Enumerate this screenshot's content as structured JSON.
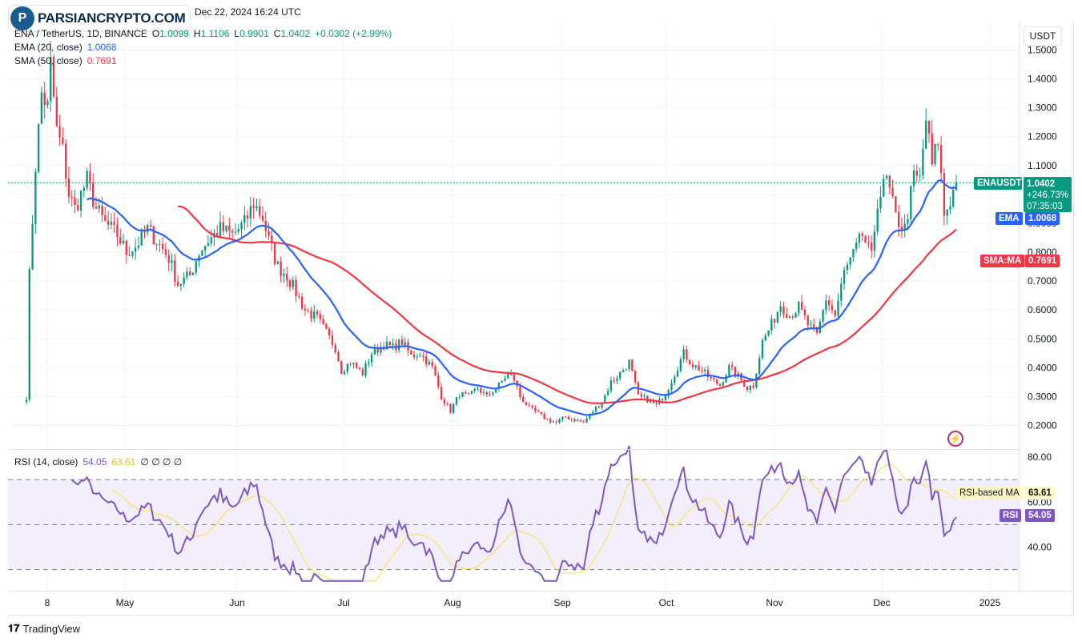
{
  "header": {
    "brand": "PARSIANCRYPTO.COM",
    "brand_logo_letter": "P",
    "date": "Dec 22, 2024 16:24 UTC"
  },
  "legend": {
    "symbol": "ENA / TetherUS, 1D, BINANCE",
    "open_label": "O",
    "open": "1.0099",
    "high_label": "H",
    "high": "1.1106",
    "low_label": "L",
    "low": "0.9901",
    "close_label": "C",
    "close": "1.0402",
    "change": "+0.0302 (+2.99%)",
    "ema_label": "EMA (20, close)",
    "ema_value": "1.0068",
    "sma_label": "SMA (50, close)",
    "sma_value": "0.7691",
    "rsi_label": "RSI (14, close)",
    "rsi_value": "54.05",
    "rsi_ma_value": "63.61",
    "rsi_extra": "∅ ∅ ∅ ∅"
  },
  "currency": "USDT",
  "price_tags": {
    "symbol": "ENAUSDT",
    "price": "1.0402",
    "change": "+246.73%",
    "countdown": "07:35:03",
    "ema_label": "EMA",
    "ema_value": "1.0068",
    "sma_label": "SMA:MA",
    "sma_value": "0.7691",
    "rsi_ma_label": "RSI-based MA",
    "rsi_ma_value": "63.61",
    "rsi_label": "RSI",
    "rsi_value": "54.05"
  },
  "footer": {
    "brand": "TradingView"
  },
  "colors": {
    "up": "#089981",
    "down": "#f23645",
    "ema": "#2962ff",
    "sma": "#f23645",
    "rsi": "#7e57c2",
    "rsi_ma": "#f7e26b",
    "rsi_band": "#f3eefc"
  },
  "chart_data": {
    "type": "candlestick",
    "price_axis": {
      "ticks": [
        "1.5000",
        "1.4000",
        "1.3000",
        "1.2000",
        "1.1000",
        "1.0000",
        "0.9000",
        "0.8000",
        "0.7000",
        "0.6000",
        "0.5000",
        "0.4000",
        "0.3000",
        "0.2000"
      ],
      "tick_values": [
        1.5,
        1.4,
        1.3,
        1.2,
        1.1,
        1.0,
        0.9,
        0.8,
        0.7,
        0.6,
        0.5,
        0.4,
        0.3,
        0.2
      ],
      "ylim": [
        0.15,
        1.55
      ]
    },
    "time_axis": {
      "ticks": [
        "8",
        "May",
        "Jun",
        "Jul",
        "Aug",
        "Sep",
        "Oct",
        "Nov",
        "Dec",
        "2025"
      ]
    },
    "rsi_axis": {
      "ticks": [
        "80.00",
        "60.00",
        "40.00"
      ],
      "tick_values": [
        80,
        60,
        40
      ],
      "overbought": 70,
      "oversold": 30,
      "ylim": [
        25,
        85
      ]
    },
    "price_anchors": [
      [
        0,
        0.3
      ],
      [
        1,
        0.72
      ],
      [
        3,
        1.1
      ],
      [
        5,
        1.35
      ],
      [
        7,
        1.3
      ],
      [
        8,
        1.45
      ],
      [
        10,
        1.22
      ],
      [
        12,
        1.15
      ],
      [
        14,
        1.0
      ],
      [
        16,
        0.95
      ],
      [
        18,
        1.0
      ],
      [
        20,
        1.05
      ],
      [
        23,
        0.95
      ],
      [
        26,
        0.9
      ],
      [
        30,
        0.86
      ],
      [
        33,
        0.8
      ],
      [
        36,
        0.82
      ],
      [
        40,
        0.88
      ],
      [
        43,
        0.84
      ],
      [
        47,
        0.78
      ],
      [
        50,
        0.69
      ],
      [
        54,
        0.72
      ],
      [
        57,
        0.8
      ],
      [
        60,
        0.84
      ],
      [
        64,
        0.88
      ],
      [
        68,
        0.86
      ],
      [
        72,
        0.9
      ],
      [
        75,
        0.97
      ],
      [
        78,
        0.92
      ],
      [
        80,
        0.84
      ],
      [
        83,
        0.75
      ],
      [
        86,
        0.72
      ],
      [
        89,
        0.66
      ],
      [
        92,
        0.6
      ],
      [
        96,
        0.57
      ],
      [
        99,
        0.52
      ],
      [
        102,
        0.47
      ],
      [
        104,
        0.39
      ],
      [
        107,
        0.42
      ],
      [
        111,
        0.38
      ],
      [
        114,
        0.45
      ],
      [
        118,
        0.48
      ],
      [
        121,
        0.47
      ],
      [
        124,
        0.49
      ],
      [
        127,
        0.44
      ],
      [
        130,
        0.45
      ],
      [
        134,
        0.4
      ],
      [
        137,
        0.3
      ],
      [
        140,
        0.25
      ],
      [
        143,
        0.31
      ],
      [
        146,
        0.3
      ],
      [
        149,
        0.33
      ],
      [
        152,
        0.3
      ],
      [
        156,
        0.34
      ],
      [
        159,
        0.38
      ],
      [
        161,
        0.36
      ],
      [
        163,
        0.3
      ],
      [
        166,
        0.26
      ],
      [
        169,
        0.24
      ],
      [
        172,
        0.22
      ],
      [
        175,
        0.21
      ],
      [
        178,
        0.23
      ],
      [
        181,
        0.22
      ],
      [
        184,
        0.21
      ],
      [
        187,
        0.25
      ],
      [
        190,
        0.28
      ],
      [
        193,
        0.35
      ],
      [
        196,
        0.38
      ],
      [
        199,
        0.42
      ],
      [
        202,
        0.3
      ],
      [
        205,
        0.29
      ],
      [
        208,
        0.27
      ],
      [
        211,
        0.31
      ],
      [
        214,
        0.38
      ],
      [
        217,
        0.45
      ],
      [
        220,
        0.41
      ],
      [
        223,
        0.39
      ],
      [
        226,
        0.36
      ],
      [
        229,
        0.34
      ],
      [
        232,
        0.4
      ],
      [
        235,
        0.37
      ],
      [
        238,
        0.33
      ],
      [
        240,
        0.34
      ],
      [
        243,
        0.49
      ],
      [
        246,
        0.55
      ],
      [
        249,
        0.62
      ],
      [
        252,
        0.58
      ],
      [
        255,
        0.61
      ],
      [
        258,
        0.55
      ],
      [
        261,
        0.51
      ],
      [
        264,
        0.64
      ],
      [
        267,
        0.58
      ],
      [
        270,
        0.73
      ],
      [
        273,
        0.79
      ],
      [
        276,
        0.86
      ],
      [
        279,
        0.78
      ],
      [
        281,
        0.98
      ],
      [
        284,
        1.05
      ],
      [
        287,
        0.92
      ],
      [
        290,
        0.88
      ],
      [
        293,
        1.06
      ],
      [
        295,
        1.05
      ],
      [
        297,
        1.26
      ],
      [
        299,
        1.1
      ],
      [
        301,
        1.19
      ],
      [
        303,
        0.93
      ],
      [
        305,
        0.98
      ],
      [
        307,
        1.04
      ]
    ],
    "n_candles": 308,
    "last_price": 1.0402,
    "ema_period": 20,
    "sma_period": 50,
    "rsi_period": 14
  }
}
